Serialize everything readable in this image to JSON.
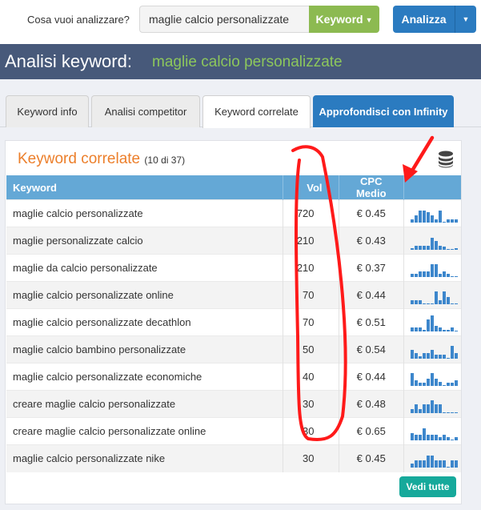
{
  "topbar": {
    "ask_label": "Cosa vuoi analizzare?",
    "search_value": "maglie calcio personalizzate",
    "type_button": "Keyword",
    "analyze_button": "Analizza",
    "colors": {
      "type_button": "#8cba51",
      "analyze_button": "#2b7bc0"
    }
  },
  "title": {
    "label": "Analisi keyword:",
    "keyword": "maglie calcio personalizzate"
  },
  "tabs": [
    {
      "label": "Keyword info",
      "active": false
    },
    {
      "label": "Analisi competitor",
      "active": false
    },
    {
      "label": "Keyword correlate",
      "active": true
    },
    {
      "label": "Approfondisci con Infinity",
      "active": false
    }
  ],
  "panel": {
    "title": "Keyword correlate",
    "count": "(10 di 37)",
    "icon": "database-icon",
    "columns": [
      "Keyword",
      "Vol",
      "CPC Medio",
      ""
    ],
    "rows": [
      {
        "keyword": "maglie calcio personalizzate",
        "vol": "720",
        "cpc": "€ 0.45",
        "trend": [
          2,
          5,
          8,
          8,
          7,
          5,
          2,
          8,
          0.3,
          2,
          2,
          2
        ]
      },
      {
        "keyword": "maglie personalizzate calcio",
        "vol": "210",
        "cpc": "€ 0.43",
        "trend": [
          1,
          3,
          3,
          3,
          3,
          8,
          6,
          3,
          2,
          0.5,
          0.3,
          1
        ]
      },
      {
        "keyword": "maglie da calcio personalizzate",
        "vol": "210",
        "cpc": "€ 0.37",
        "trend": [
          2,
          2,
          4,
          4,
          4,
          9,
          9,
          2,
          4,
          2,
          0.3,
          0.3
        ]
      },
      {
        "keyword": "maglie calcio personalizzate online",
        "vol": "70",
        "cpc": "€ 0.44",
        "trend": [
          3,
          3,
          3,
          0.3,
          0.3,
          0.3,
          9,
          3,
          9,
          5,
          0.3,
          0.3
        ]
      },
      {
        "keyword": "maglie calcio personalizzate decathlon",
        "vol": "70",
        "cpc": "€ 0.51",
        "trend": [
          3,
          3,
          3,
          1,
          8,
          11,
          4,
          3,
          1,
          1,
          3,
          0.3
        ]
      },
      {
        "keyword": "maglie calcio bambino personalizzate",
        "vol": "50",
        "cpc": "€ 0.54",
        "trend": [
          6,
          4,
          1.5,
          4,
          4,
          6,
          3,
          3,
          3,
          0.3,
          9,
          4
        ]
      },
      {
        "keyword": "maglie calcio personalizzate economiche",
        "vol": "40",
        "cpc": "€ 0.44",
        "trend": [
          9,
          4,
          2,
          2,
          5,
          9,
          5,
          3,
          0.3,
          2,
          2,
          4
        ]
      },
      {
        "keyword": "creare maglie calcio personalizzate",
        "vol": "30",
        "cpc": "€ 0.48",
        "trend": [
          3,
          6,
          3,
          6,
          6,
          9,
          6,
          6,
          0.3,
          0.3,
          0.3,
          0.3
        ]
      },
      {
        "keyword": "creare maglie calcio personalizzate online",
        "vol": "30",
        "cpc": "€ 0.65",
        "trend": [
          5,
          4,
          4,
          8,
          4,
          4,
          4,
          2,
          4,
          2,
          0.3,
          2
        ]
      },
      {
        "keyword": "maglie calcio personalizzate nike",
        "vol": "30",
        "cpc": "€ 0.45",
        "trend": [
          3,
          5,
          5,
          5,
          8,
          8,
          5,
          5,
          5,
          0.3,
          5,
          5
        ]
      }
    ],
    "footer_button": "Vedi tutte",
    "colors": {
      "title": "#ec7f2b",
      "header": "#64a8d6",
      "spark": "#3d87cc",
      "footer_button": "#16a99b"
    }
  }
}
